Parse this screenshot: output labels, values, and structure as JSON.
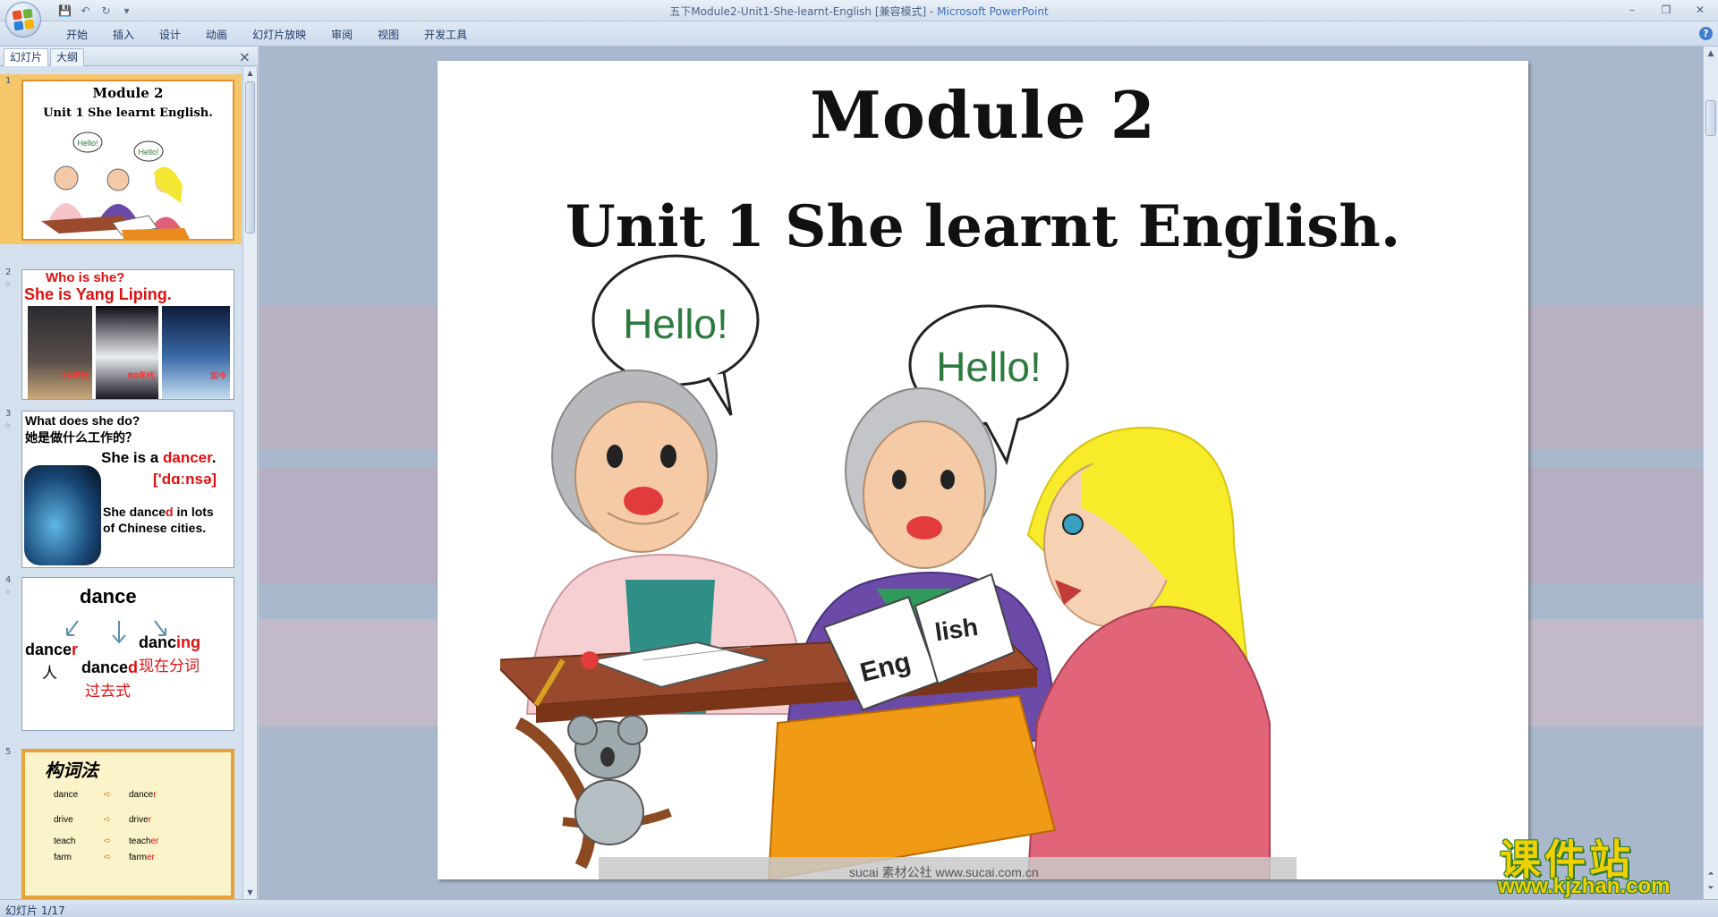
{
  "window": {
    "title": "五下Module2-Unit1-She-learnt-English [兼容模式] - ",
    "app_name": "Microsoft PowerPoint",
    "minimize": "–",
    "restore": "❐",
    "close": "✕"
  },
  "qat": {
    "save": "💾",
    "undo": "↶",
    "redo": "↻",
    "customize": "▾"
  },
  "ribbon": {
    "tabs": [
      "开始",
      "插入",
      "设计",
      "动画",
      "幻灯片放映",
      "审阅",
      "视图",
      "开发工具"
    ],
    "help": "?"
  },
  "pane": {
    "tabs": {
      "slides": "幻灯片",
      "outline": "大纲"
    },
    "close": "×"
  },
  "thumbnails": {
    "s1": {
      "num": "1",
      "title": "Module 2",
      "subtitle": "Unit 1 She learnt English.",
      "bubble1": "Hello!",
      "bubble2": "Hello!"
    },
    "s2": {
      "num": "2",
      "line1": "Who is she?",
      "line2": "She is Yang Liping.",
      "cap1": "70年代",
      "cap2": "80年代",
      "cap3": "如今"
    },
    "s3": {
      "num": "3",
      "q1": "What does she do?",
      "q2": "她是做什么工作的？",
      "a1_pre": "She is a ",
      "a1_word": "dancer",
      "a1_post": ".",
      "phon": "['dɑːnsə]",
      "s_pre": "She  dance",
      "s_d": "d",
      "s_post": " in lots",
      "s_line2": "of Chinese cities."
    },
    "s4": {
      "num": "4",
      "word": "dance",
      "w1_base": "dance",
      "w1_suf": "r",
      "w1_cn": "人",
      "w2_base": "dance",
      "w2_suf": "d",
      "w2_cn": "过去式",
      "w3_base": "danc",
      "w3_suf": "ing",
      "w3_cn": "现在分词"
    },
    "s5": {
      "num": "5",
      "title": "构词法",
      "rows": [
        {
          "a": "dance",
          "b_base": "dance",
          "b_suf": "r"
        },
        {
          "a": "drive",
          "b_base": "drive",
          "b_suf": "r"
        },
        {
          "a": "teach",
          "b_base": "teach",
          "b_suf": "er"
        },
        {
          "a": "farm",
          "b_base": "farm",
          "b_suf": "er"
        }
      ]
    }
  },
  "slide": {
    "title": "Module 2",
    "subtitle": "Unit 1 She learnt English.",
    "bubble1": "Hello!",
    "bubble2": "Hello!",
    "book_text1": "Eng",
    "book_text2": "lish",
    "footer_text": "sucai  素材公社  www.sucai.com.cn"
  },
  "status": {
    "text": "幻灯片 1/17"
  },
  "watermark": {
    "cn": "课件站",
    "url": "www.kjzhan.com"
  },
  "colors": {
    "accent": "#3a6fb8",
    "selected_thumb": "#f6c66b",
    "red_text": "#e01010"
  }
}
